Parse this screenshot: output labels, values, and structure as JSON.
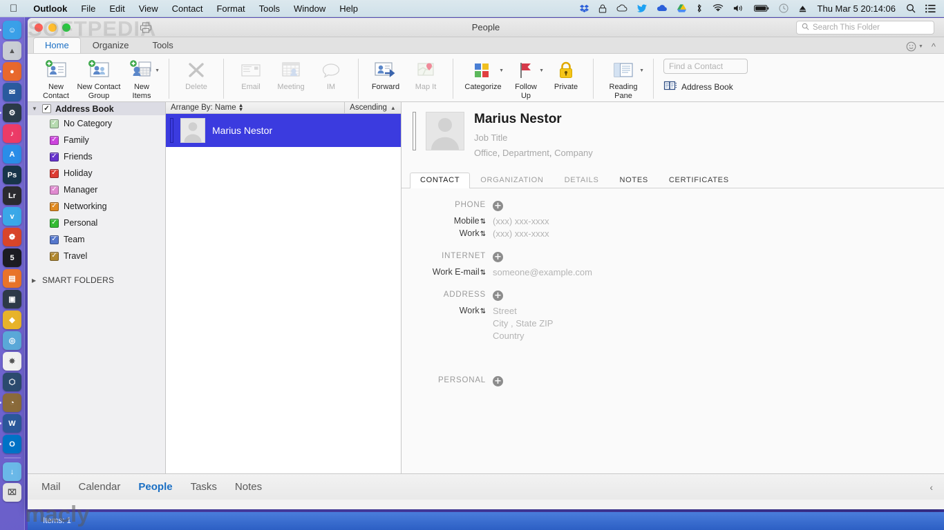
{
  "menubar": {
    "apple_icon": "apple-logo",
    "items": [
      {
        "label": "Outlook",
        "bold": true
      },
      {
        "label": "File",
        "bold": false
      },
      {
        "label": "Edit",
        "bold": false
      },
      {
        "label": "View",
        "bold": false
      },
      {
        "label": "Contact",
        "bold": false
      },
      {
        "label": "Format",
        "bold": false
      },
      {
        "label": "Tools",
        "bold": false
      },
      {
        "label": "Window",
        "bold": false
      },
      {
        "label": "Help",
        "bold": false
      }
    ],
    "status_icons": [
      {
        "name": "dropbox-icon",
        "glyph": "❖"
      },
      {
        "name": "lock-icon",
        "glyph": "⚿"
      },
      {
        "name": "cloud-icon",
        "glyph": "☁"
      },
      {
        "name": "twitter-icon",
        "glyph": "ᴠ"
      },
      {
        "name": "cloud-download-icon",
        "glyph": "☁"
      },
      {
        "name": "drive-icon",
        "glyph": "△"
      },
      {
        "name": "bluetooth-icon",
        "glyph": "ᛗ"
      },
      {
        "name": "wifi-icon",
        "glyph": "◠"
      },
      {
        "name": "volume-icon",
        "glyph": "ὐA"
      },
      {
        "name": "battery-icon",
        "glyph": "▭"
      },
      {
        "name": "timemachine-icon",
        "glyph": "◴"
      },
      {
        "name": "eject-icon",
        "glyph": "⏏"
      }
    ],
    "clock": "Thu Mar 5  20:14:06",
    "search_icon": "spotlight-search-icon",
    "notification_icon": "notification-center-icon"
  },
  "dock": {
    "items": [
      {
        "name": "finder",
        "label": "☺",
        "color": "#3aa0e8",
        "running": true
      },
      {
        "name": "launchpad",
        "label": "▲",
        "color": "#c9cdd4",
        "running": false
      },
      {
        "name": "firefox",
        "label": "●",
        "color": "#e8682c",
        "running": true
      },
      {
        "name": "thunderbird",
        "label": "✉",
        "color": "#2a5a9e",
        "running": false
      },
      {
        "name": "steam",
        "label": "⚙",
        "color": "#2b3a48",
        "running": true
      },
      {
        "name": "itunes",
        "label": "♪",
        "color": "#ec3b67",
        "running": false
      },
      {
        "name": "app-store",
        "label": "A",
        "color": "#2a8de8",
        "running": false
      },
      {
        "name": "photoshop",
        "label": "Ps",
        "color": "#18354a",
        "running": false
      },
      {
        "name": "lightroom",
        "label": "Lr",
        "color": "#2b2b30",
        "running": false
      },
      {
        "name": "twitter",
        "label": "ᴠ",
        "color": "#3aa8e8",
        "running": true
      },
      {
        "name": "popcorn-time",
        "label": "❁",
        "color": "#d8452a",
        "running": false
      },
      {
        "name": "500px",
        "label": "5",
        "color": "#1c1c22",
        "running": false
      },
      {
        "name": "calendar",
        "label": "▤",
        "color": "#e8732a",
        "running": false
      },
      {
        "name": "screen-sharing",
        "label": "▣",
        "color": "#2e3a48",
        "running": false
      },
      {
        "name": "transmission",
        "label": "◆",
        "color": "#e8b32a",
        "running": false
      },
      {
        "name": "disk-utility",
        "label": "◎",
        "color": "#5aa8d8",
        "running": false
      },
      {
        "name": "photos",
        "label": "✸",
        "color": "#f0f0f0",
        "running": false
      },
      {
        "name": "virtualbox",
        "label": "⬡",
        "color": "#2b4a6e",
        "running": false
      },
      {
        "name": "gimp",
        "label": "◔",
        "color": "#8a6a3a",
        "running": true
      },
      {
        "name": "word",
        "label": "W",
        "color": "#2b579a",
        "running": true
      },
      {
        "name": "outlook",
        "label": "O",
        "color": "#0072c6",
        "running": true
      },
      {
        "name": "downloads-folder",
        "label": "↓",
        "color": "#6ab8e8",
        "running": false
      },
      {
        "name": "trash",
        "label": "⌧",
        "color": "#e4e4e4",
        "running": false
      }
    ]
  },
  "window": {
    "title": "People",
    "traffic_lights": [
      "close",
      "minimize",
      "zoom"
    ],
    "print_icon": "printer-icon",
    "search_folder": {
      "placeholder": "Search This Folder",
      "icon": "search-icon"
    },
    "emoji_icon": "smiley-icon",
    "collapse_ribbon_icon": "chevron-up-icon"
  },
  "ribbon": {
    "tabs": [
      {
        "label": "Home",
        "active": true
      },
      {
        "label": "Organize",
        "active": false
      },
      {
        "label": "Tools",
        "active": false
      }
    ],
    "groups": [
      {
        "name": "new",
        "buttons": [
          {
            "label": "New\nContact",
            "line1": "New",
            "line2": "Contact",
            "icon": "new-contact-icon",
            "disabled": false,
            "caret": false
          },
          {
            "label": "New Contact Group",
            "line1": "New Contact",
            "line2": "Group",
            "icon": "new-contact-group-icon",
            "disabled": false,
            "caret": false
          },
          {
            "label": "New Items",
            "line1": "New",
            "line2": "Items",
            "icon": "new-items-icon",
            "disabled": false,
            "caret": true
          }
        ]
      },
      {
        "name": "delete",
        "buttons": [
          {
            "line1": "Delete",
            "line2": "",
            "icon": "delete-icon",
            "disabled": true,
            "caret": false
          }
        ]
      },
      {
        "name": "communicate",
        "buttons": [
          {
            "line1": "Email",
            "line2": "",
            "icon": "email-icon",
            "disabled": true,
            "caret": false
          },
          {
            "line1": "Meeting",
            "line2": "",
            "icon": "meeting-icon",
            "disabled": true,
            "caret": false
          },
          {
            "line1": "IM",
            "line2": "",
            "icon": "im-icon",
            "disabled": true,
            "caret": false
          }
        ]
      },
      {
        "name": "actions",
        "buttons": [
          {
            "line1": "Forward",
            "line2": "",
            "icon": "forward-icon",
            "disabled": false,
            "caret": false
          },
          {
            "line1": "Map It",
            "line2": "",
            "icon": "map-it-icon",
            "disabled": true,
            "caret": false
          }
        ]
      },
      {
        "name": "tags",
        "buttons": [
          {
            "line1": "Categorize",
            "line2": "",
            "icon": "categorize-icon",
            "disabled": false,
            "caret": true
          },
          {
            "line1": "Follow",
            "line2": "Up",
            "icon": "follow-up-flag-icon",
            "disabled": false,
            "caret": true
          },
          {
            "line1": "Private",
            "line2": "",
            "icon": "private-lock-icon",
            "disabled": false,
            "caret": false
          }
        ]
      },
      {
        "name": "view",
        "buttons": [
          {
            "line1": "Reading",
            "line2": "Pane",
            "icon": "reading-pane-icon",
            "disabled": false,
            "caret": true
          }
        ]
      }
    ],
    "find_contact": {
      "placeholder": "Find a Contact",
      "value": ""
    },
    "address_book": {
      "label": "Address Book",
      "icon": "address-book-icon"
    }
  },
  "sidebar": {
    "header": {
      "label": "Address Book",
      "checked": true,
      "expanded": true
    },
    "categories": [
      {
        "label": "No Category",
        "color": "#b6dbb0",
        "checked": true
      },
      {
        "label": "Family",
        "color": "#cc44dd",
        "checked": true
      },
      {
        "label": "Friends",
        "color": "#6633cc",
        "checked": true
      },
      {
        "label": "Holiday",
        "color": "#dd3b33",
        "checked": true
      },
      {
        "label": "Manager",
        "color": "#e08ad0",
        "checked": true
      },
      {
        "label": "Networking",
        "color": "#e08a22",
        "checked": true
      },
      {
        "label": "Personal",
        "color": "#33bb33",
        "checked": true
      },
      {
        "label": "Team",
        "color": "#5577cc",
        "checked": true
      },
      {
        "label": "Travel",
        "color": "#b08830",
        "checked": true
      }
    ],
    "smart_folders": {
      "label": "SMART FOLDERS",
      "expanded": false
    }
  },
  "contact_list": {
    "arrange_by_label": "Arrange By: Name",
    "sort_order": "Ascending",
    "sort_arrow": "▲",
    "rows": [
      {
        "name": "Marius Nestor",
        "selected": true,
        "avatar": "person-placeholder-icon"
      }
    ]
  },
  "detail": {
    "avatar": "person-placeholder-icon",
    "name": "Marius Nestor",
    "job_title": "Job Title",
    "office": "Office",
    "department": "Department",
    "company": "Company",
    "tabs": [
      {
        "label": "CONTACT",
        "active": true,
        "dim": false
      },
      {
        "label": "ORGANIZATION",
        "active": false,
        "dim": true
      },
      {
        "label": "DETAILS",
        "active": false,
        "dim": true
      },
      {
        "label": "NOTES",
        "active": false,
        "dim": false
      },
      {
        "label": "CERTIFICATES",
        "active": false,
        "dim": false
      }
    ],
    "sections": [
      {
        "title": "PHONE",
        "add_icon": "add-field-icon",
        "fields": [
          {
            "label": "Mobile",
            "stepper": true,
            "value": "(xxx) xxx-xxxx"
          },
          {
            "label": "Work",
            "stepper": true,
            "value": "(xxx) xxx-xxxx"
          }
        ]
      },
      {
        "title": "INTERNET",
        "add_icon": "add-field-icon",
        "fields": [
          {
            "label": "Work E-mail",
            "stepper": true,
            "value": "someone@example.com"
          }
        ]
      },
      {
        "title": "ADDRESS",
        "add_icon": "add-field-icon",
        "fields": [
          {
            "label": "Work",
            "stepper": true,
            "value": "Street"
          },
          {
            "label": "",
            "stepper": false,
            "value": "City , State ZIP"
          },
          {
            "label": "",
            "stepper": false,
            "value": "Country"
          }
        ]
      },
      {
        "title": "PERSONAL",
        "add_icon": "add-field-icon",
        "fields": []
      }
    ]
  },
  "bottom_nav": {
    "items": [
      {
        "label": "Mail",
        "active": false
      },
      {
        "label": "Calendar",
        "active": false
      },
      {
        "label": "People",
        "active": true
      },
      {
        "label": "Tasks",
        "active": false
      },
      {
        "label": "Notes",
        "active": false
      }
    ],
    "collapse_icon": "chevron-left-icon"
  },
  "status_bar": {
    "text": "Items: 1"
  },
  "watermarks": {
    "top": "SOFTPEDIA",
    "bottom": "macly"
  },
  "colors": {
    "selection_blue": "#3b3bdf",
    "accent_link": "#1a6fc4",
    "status_bar_blue": "#2c5fc4"
  }
}
